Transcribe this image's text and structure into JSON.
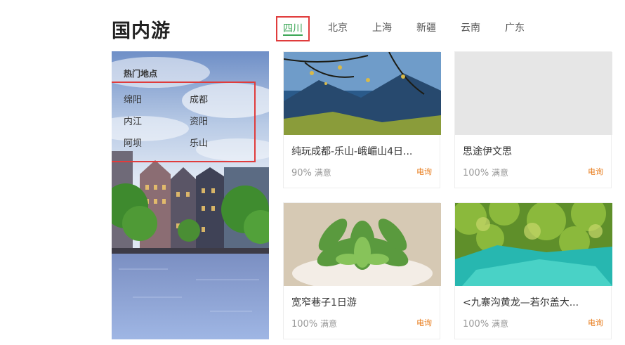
{
  "section_title": "国内游",
  "tabs": [
    {
      "label": "四川",
      "active": true
    },
    {
      "label": "北京"
    },
    {
      "label": "上海"
    },
    {
      "label": "新疆"
    },
    {
      "label": "云南"
    },
    {
      "label": "广东"
    }
  ],
  "hot_places": {
    "title": "热门地点",
    "items": [
      "绵阳",
      "成都",
      "内江",
      "资阳",
      "阿坝",
      "乐山"
    ]
  },
  "cards": [
    {
      "name": "纯玩成都-乐山-峨嵋山4日...",
      "satisfaction": "90%",
      "sat_label": "满意",
      "action": "电询"
    },
    {
      "name": "思途伊文思",
      "satisfaction": "100%",
      "sat_label": "满意",
      "action": "电询"
    },
    {
      "name": "宽窄巷子1日游",
      "satisfaction": "100%",
      "sat_label": "满意",
      "action": "电询"
    },
    {
      "name": "<九寨沟黄龙—若尔盖大...",
      "satisfaction": "100%",
      "sat_label": "满意",
      "action": "电询"
    }
  ],
  "colors": {
    "accent_green": "#3aa655",
    "highlight_red": "#e03c3c",
    "action_orange": "#e87b1a"
  }
}
